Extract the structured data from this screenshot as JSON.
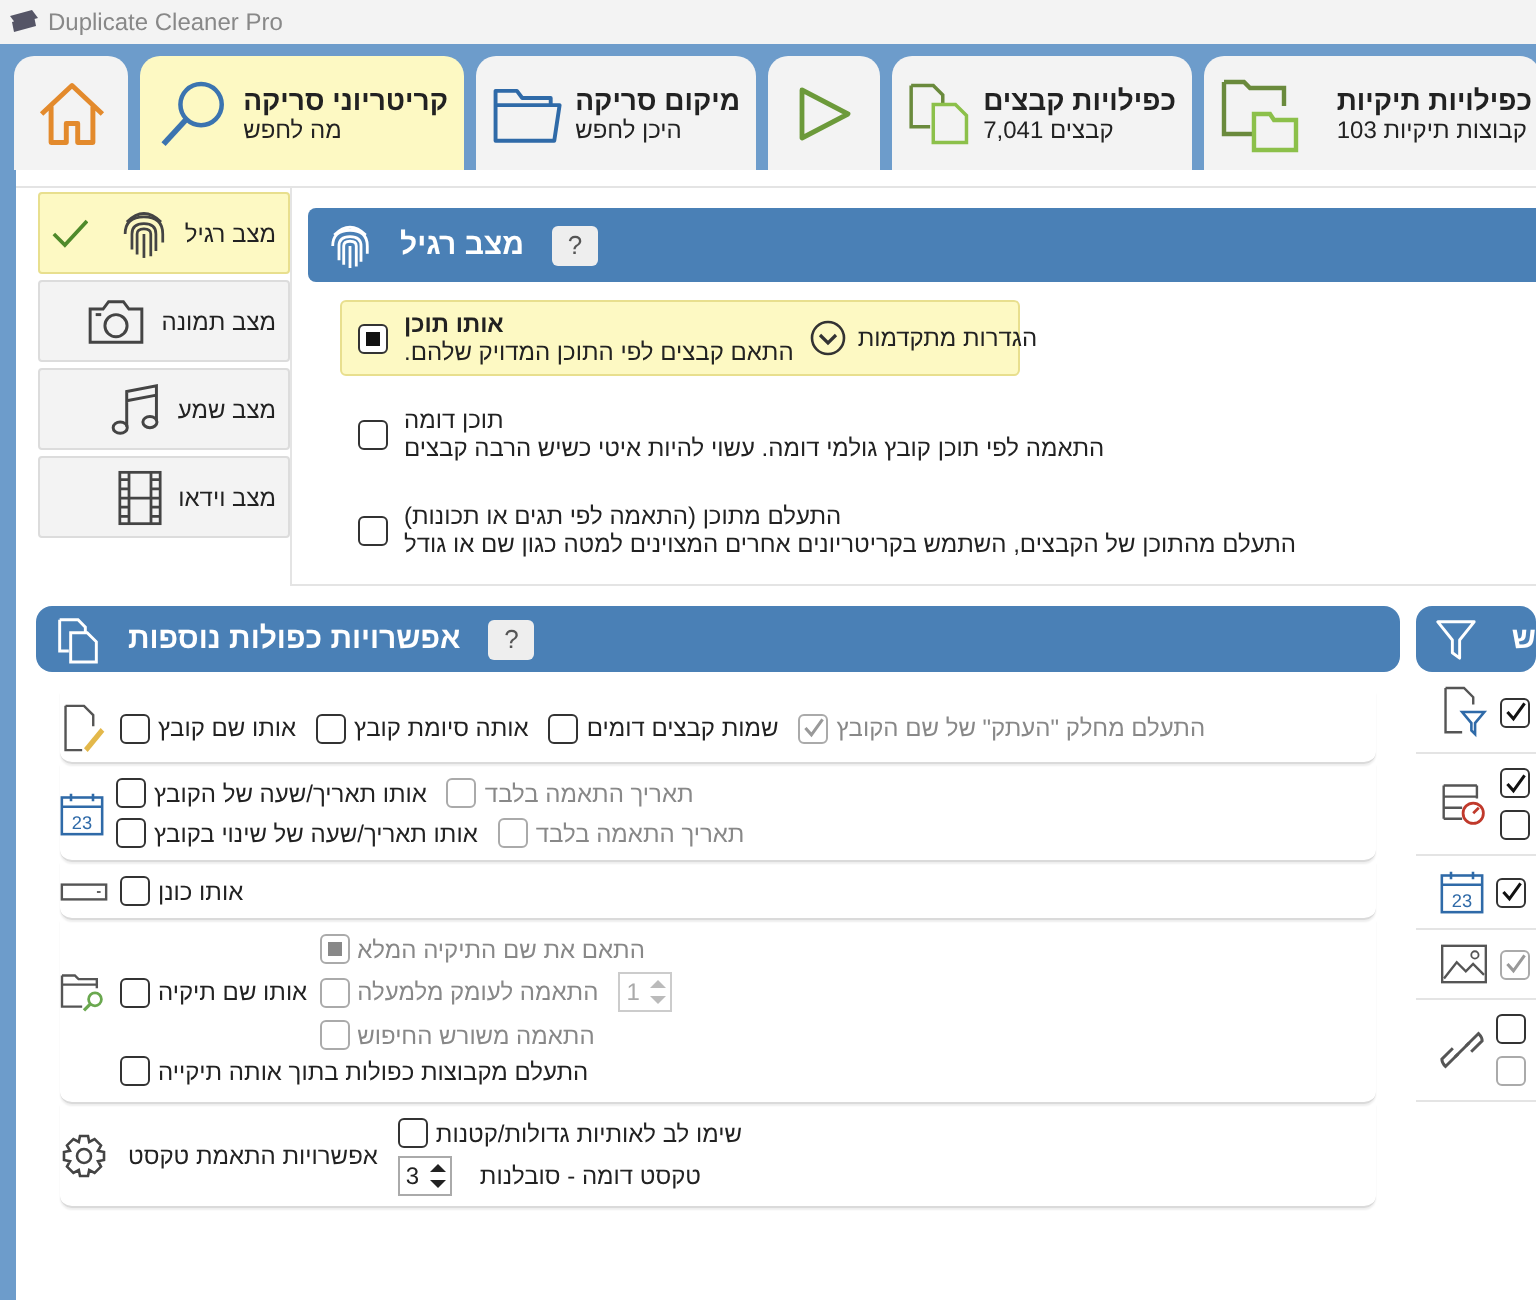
{
  "window": {
    "title": "Duplicate Cleaner Pro"
  },
  "tabs": [
    {
      "kind": "folders",
      "title": "כפילויות תיקיות",
      "subtitle": "קבוצות תיקיות 103",
      "selected": false
    },
    {
      "kind": "files",
      "title": "כפילויות קבצים",
      "subtitle": "קבצים 7,041",
      "selected": false
    },
    {
      "kind": "play",
      "selected": false
    },
    {
      "kind": "folder",
      "title": "מיקום סריקה",
      "subtitle": "היכן לחפש",
      "selected": false
    },
    {
      "kind": "search",
      "title": "קריטריוני סריקה",
      "subtitle": "מה לחפש",
      "selected": true
    },
    {
      "kind": "home",
      "selected": false
    }
  ],
  "modes": [
    {
      "kind": "fingerprint",
      "label": "מצב רגיל",
      "selected": true
    },
    {
      "kind": "camera",
      "label": "מצב תמונה",
      "selected": false
    },
    {
      "kind": "music",
      "label": "מצב שמע",
      "selected": false
    },
    {
      "kind": "film",
      "label": "מצב וידאו",
      "selected": false
    }
  ],
  "mode_panel": {
    "title": "מצב רגיל",
    "help": "?",
    "options": [
      {
        "title": "אותו תוכן",
        "description": "התאם קבצים לפי התוכן המדויק שלהם.",
        "advanced": "הגדרות מתקדמות",
        "selected": true
      },
      {
        "title": "תוכן דומה",
        "description": "התאמה לפי תוכן קובץ גולמי דומה. עשוי להיות איטי כשיש הרבה קבצים",
        "selected": false
      },
      {
        "title": "התעלם מתוכן (התאמה לפי תגים או תכונות)",
        "description": "התעלם מהתוכן של הקבצים, השתמש בקריטריונים אחרים המצוינים למטה כגון שם או גודל",
        "selected": false
      }
    ]
  },
  "extra_panel": {
    "title": "אפשרויות כפולות נוספות",
    "help": "?",
    "groups": [
      {
        "kind": "file-name",
        "columns": [
          [
            [
              {
                "kind": "checkbox",
                "label": "התעלם מחלק \"העתק\" של שם הקובץ",
                "checked": true,
                "disabled": true
              },
              {
                "kind": "checkbox",
                "label": "שמות קבצים דומים",
                "checked": false,
                "disabled": false
              },
              {
                "kind": "checkbox",
                "label": "אותה סיומת קובץ",
                "checked": false,
                "disabled": false
              },
              {
                "kind": "checkbox",
                "label": "אותו שם קובץ",
                "checked": false,
                "disabled": false
              }
            ]
          ]
        ]
      },
      {
        "kind": "date",
        "icon_text": "23",
        "columns": [
          [
            [
              {
                "kind": "checkbox",
                "label": "תאריך התאמה בלבד",
                "checked": false,
                "disabled": true
              },
              {
                "kind": "checkbox",
                "label": "אותו תאריך/שעה של הקובץ",
                "checked": false,
                "disabled": false
              }
            ],
            [
              {
                "kind": "checkbox",
                "label": "תאריך התאמה בלבד",
                "checked": false,
                "disabled": true
              },
              {
                "kind": "checkbox",
                "label": "אותו תאריך/שעה של שינוי בקובץ",
                "checked": false,
                "disabled": false
              }
            ]
          ]
        ]
      },
      {
        "kind": "drive",
        "columns": [
          [
            [
              {
                "kind": "checkbox",
                "label": "אותו כונן",
                "checked": false,
                "disabled": false
              }
            ]
          ]
        ]
      },
      {
        "kind": "folder",
        "columns": [
          [
            [
              {
                "kind": "radio",
                "label": "התאם את שם התיקיה המלא",
                "selected": true,
                "disabled": true
              }
            ],
            [
              {
                "kind": "spinner",
                "value": "1",
                "disabled": true
              },
              {
                "kind": "radio",
                "label": "התאמה לעומק מלמעלה",
                "selected": false,
                "disabled": true
              }
            ],
            [
              {
                "kind": "radio",
                "label": "התאמה משורש החיפוש",
                "selected": false,
                "disabled": true
              }
            ]
          ],
          [
            [
              {
                "kind": "checkbox",
                "label": "אותו שם תיקיה",
                "checked": false,
                "disabled": false
              }
            ]
          ]
        ],
        "footer": [
          {
            "kind": "checkbox",
            "label": "התעלם מקבוצות כפולות בתוך אותה תיקייה",
            "checked": false,
            "disabled": false
          }
        ]
      },
      {
        "kind": "text",
        "columns": [
          [
            [
              {
                "kind": "checkbox",
                "label": "שימו לב לאותיות גדולות/קטנות",
                "checked": false,
                "disabled": false
              }
            ],
            [
              {
                "kind": "label",
                "label": "טקסט דומה - סובלנות"
              },
              {
                "kind": "spinner",
                "value": "3",
                "disabled": false
              }
            ]
          ],
          [
            [
              {
                "kind": "label",
                "label": "אפשרויות התאמת טקסט"
              }
            ]
          ]
        ]
      }
    ]
  },
  "side_panel": {
    "title": "ש",
    "groups": [
      {
        "kind": "filter",
        "checks": [
          {
            "checked": true,
            "disabled": false
          }
        ]
      },
      {
        "kind": "list",
        "checks": [
          {
            "checked": true,
            "disabled": false
          },
          {
            "checked": false,
            "disabled": false
          }
        ]
      },
      {
        "kind": "calendar",
        "icon_text": "23",
        "checks": [
          {
            "checked": true,
            "disabled": false
          }
        ]
      },
      {
        "kind": "image",
        "checks": [
          {
            "checked": true,
            "disabled": true
          }
        ]
      },
      {
        "kind": "link",
        "checks": [
          {
            "checked": false,
            "disabled": false
          },
          {
            "checked": false,
            "disabled": true
          }
        ]
      }
    ]
  }
}
